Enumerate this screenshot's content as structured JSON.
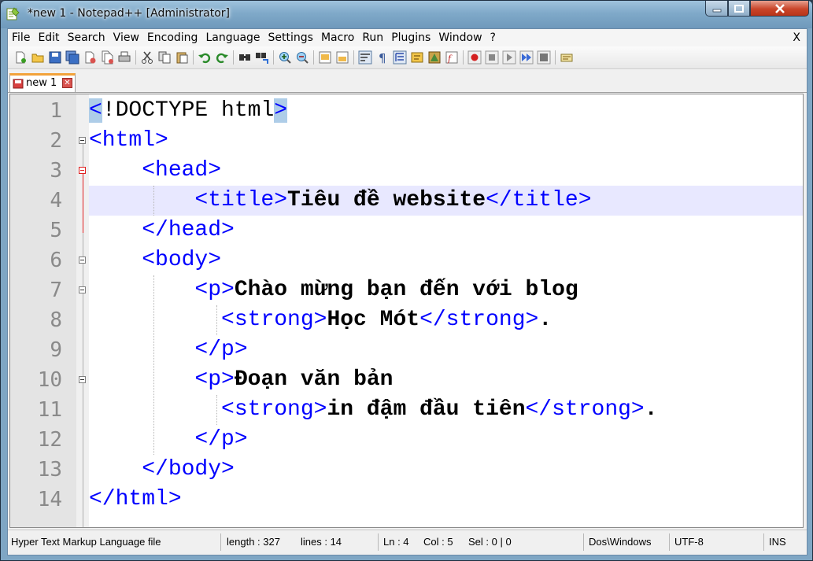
{
  "window": {
    "title": "*new 1 - Notepad++ [Administrator]",
    "app_icon": "notepad-plus-plus-icon",
    "controls": {
      "minimize": "minimize-icon",
      "maximize": "maximize-icon",
      "close": "close-icon"
    }
  },
  "menu": {
    "items": [
      "File",
      "Edit",
      "Search",
      "View",
      "Encoding",
      "Language",
      "Settings",
      "Macro",
      "Run",
      "Plugins",
      "Window",
      "?"
    ],
    "close_doc": "X"
  },
  "toolbar": {
    "icons": [
      "new-file-icon",
      "open-file-icon",
      "save-icon",
      "save-all-icon",
      "close-icon",
      "close-all-icon",
      "print-icon",
      "cut-icon",
      "copy-icon",
      "paste-icon",
      "undo-icon",
      "redo-icon",
      "find-icon",
      "replace-icon",
      "zoom-in-icon",
      "zoom-out-icon",
      "sync-vertical-icon",
      "sync-horizontal-icon",
      "word-wrap-icon",
      "show-all-chars-icon",
      "indent-guide-icon",
      "user-defined-language-icon",
      "document-map-icon",
      "function-list-icon",
      "record-macro-icon",
      "stop-record-icon",
      "play-macro-icon",
      "run-macro-multiple-icon",
      "save-macro-icon",
      "spell-check-icon"
    ]
  },
  "tab": {
    "label": "new 1",
    "icon": "unsaved-file-icon",
    "close_icon": "tab-close-icon"
  },
  "editor": {
    "current_line": 4,
    "lines": [
      {
        "n": "1",
        "indent": "",
        "segments": [
          [
            "br",
            "<"
          ],
          [
            "dt",
            "!DOCTYPE html"
          ],
          [
            "br",
            ">"
          ]
        ]
      },
      {
        "n": "2",
        "indent": "",
        "segments": [
          [
            "tg",
            "<html>"
          ]
        ]
      },
      {
        "n": "3",
        "indent": "    ",
        "segments": [
          [
            "tg",
            "<head>"
          ]
        ]
      },
      {
        "n": "4",
        "indent": "        ",
        "segments": [
          [
            "tg",
            "<title>"
          ],
          [
            "tx",
            "Tiêu đề website"
          ],
          [
            "tg",
            "</title>"
          ]
        ]
      },
      {
        "n": "5",
        "indent": "    ",
        "segments": [
          [
            "tg",
            "</head>"
          ]
        ]
      },
      {
        "n": "6",
        "indent": "    ",
        "segments": [
          [
            "tg",
            "<body>"
          ]
        ]
      },
      {
        "n": "7",
        "indent": "        ",
        "segments": [
          [
            "tg",
            "<p>"
          ],
          [
            "tx",
            "Chào mừng bạn đến với blog"
          ]
        ]
      },
      {
        "n": "8",
        "indent": "          ",
        "segments": [
          [
            "tg",
            "<strong>"
          ],
          [
            "tx",
            "Học Mót"
          ],
          [
            "tg",
            "</strong>"
          ],
          [
            "tx",
            "."
          ]
        ]
      },
      {
        "n": "9",
        "indent": "        ",
        "segments": [
          [
            "tg",
            "</p>"
          ]
        ]
      },
      {
        "n": "10",
        "indent": "        ",
        "segments": [
          [
            "tg",
            "<p>"
          ],
          [
            "tx",
            "Đoạn văn bản"
          ]
        ]
      },
      {
        "n": "11",
        "indent": "          ",
        "segments": [
          [
            "tg",
            "<strong>"
          ],
          [
            "tx",
            "in đậm đầu tiên"
          ],
          [
            "tg",
            "</strong>"
          ],
          [
            "tx",
            "."
          ]
        ]
      },
      {
        "n": "12",
        "indent": "        ",
        "segments": [
          [
            "tg",
            "</p>"
          ]
        ]
      },
      {
        "n": "13",
        "indent": "    ",
        "segments": [
          [
            "tg",
            "</body>"
          ]
        ]
      },
      {
        "n": "14",
        "indent": "",
        "segments": [
          [
            "tg",
            "</html>"
          ]
        ]
      }
    ]
  },
  "status": {
    "filetype": "Hyper Text Markup Language file",
    "length": "length : 327",
    "lines": "lines : 14",
    "ln": "Ln : 4",
    "col": "Col : 5",
    "sel": "Sel : 0 | 0",
    "eol": "Dos\\Windows",
    "encoding": "UTF-8",
    "mode": "INS"
  },
  "colors": {
    "tag": "#0000ff",
    "text": "#000000",
    "current_line_bg": "#e8e8ff",
    "brace_match_bg": "#aecde8",
    "tab_accent": "#f2a23a"
  }
}
